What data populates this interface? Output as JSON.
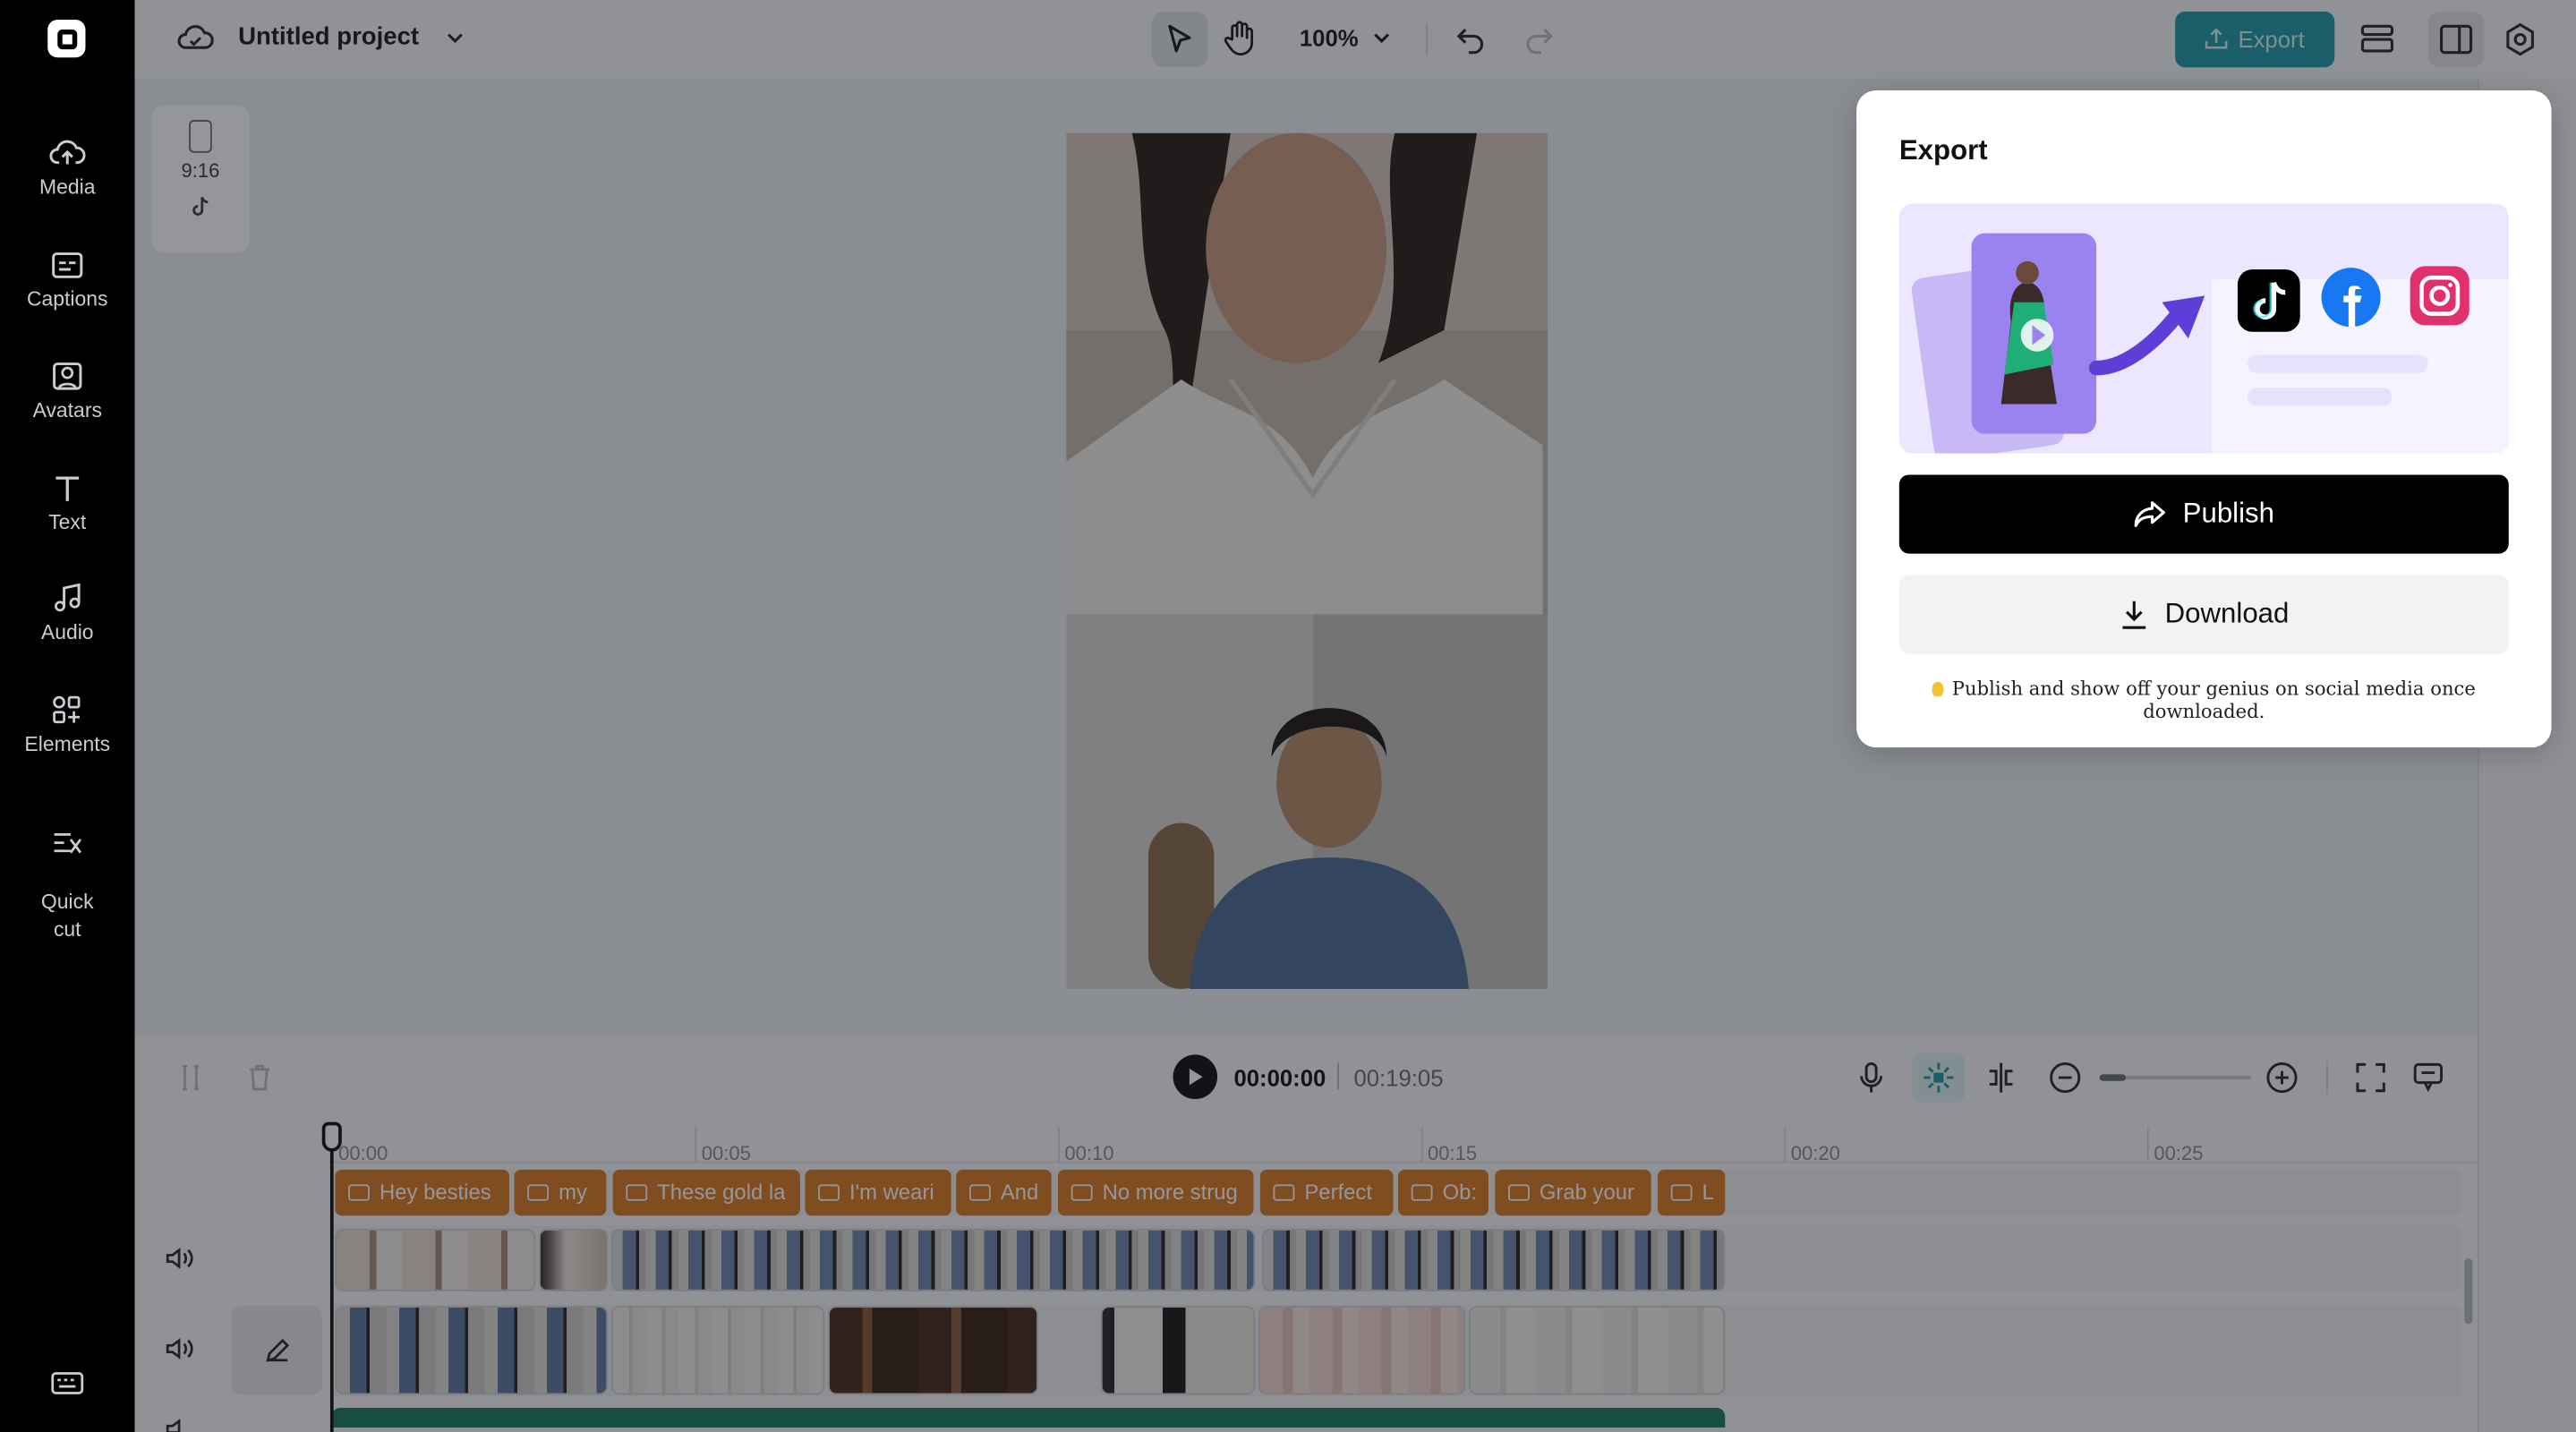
{
  "app": {
    "project_title": "Untitled project",
    "zoom": "100%",
    "export_label": "Export"
  },
  "sidebar": {
    "items": [
      {
        "label": "Media",
        "icon": "cloud-upload-icon"
      },
      {
        "label": "Captions",
        "icon": "captions-icon"
      },
      {
        "label": "Avatars",
        "icon": "avatar-icon"
      },
      {
        "label": "Text",
        "icon": "text-icon"
      },
      {
        "label": "Audio",
        "icon": "music-note-icon"
      },
      {
        "label": "Elements",
        "icon": "elements-icon"
      },
      {
        "label": "Quick\ncut",
        "icon": "quick-cut-icon"
      }
    ]
  },
  "canvas": {
    "aspect_ratio": "9:16"
  },
  "timeline": {
    "current_time": "00:00:00",
    "total_time": "00:19:05",
    "ruler_labels": [
      "00:00",
      "00:05",
      "00:10",
      "00:15",
      "00:20",
      "00:25"
    ],
    "captions": [
      "Hey besties",
      "my",
      "These gold la",
      "I'm weari",
      "And",
      "No more strug",
      "Perfect",
      "Ob:",
      "Grab your",
      "L"
    ]
  },
  "export_panel": {
    "title": "Export",
    "publish_label": "Publish",
    "download_label": "Download",
    "hint": "Publish and show off your genius on social media once downloaded."
  },
  "colors": {
    "accent": "#1f9aa8",
    "caption_clip": "#d97a23",
    "sidebar_bg": "#000000",
    "banner_bg": "#ece7ff"
  }
}
